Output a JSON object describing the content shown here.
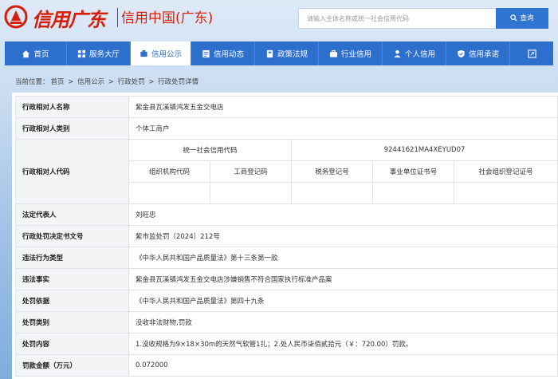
{
  "header": {
    "logo_script": "信用广东",
    "logo_cn": "信用中国(广东)",
    "search_placeholder": "请输入主体名称或统一社会信用代码",
    "search_button": "查询",
    "colors": {
      "brand_red": "#d81e06",
      "nav_blue": "#2c6fcc"
    }
  },
  "nav": {
    "items": [
      {
        "label": "首页",
        "icon": "home-icon",
        "active": false
      },
      {
        "label": "服务大厅",
        "icon": "grid-icon",
        "active": false
      },
      {
        "label": "信用公示",
        "icon": "announce-icon",
        "active": true
      },
      {
        "label": "信用动态",
        "icon": "news-icon",
        "active": false
      },
      {
        "label": "政策法规",
        "icon": "book-icon",
        "active": false
      },
      {
        "label": "行业信用",
        "icon": "briefcase-icon",
        "active": false
      },
      {
        "label": "个人信用",
        "icon": "person-icon",
        "active": false
      },
      {
        "label": "信用承诺",
        "icon": "shield-check-icon",
        "active": false
      }
    ],
    "end_icon": "expand-icon"
  },
  "breadcrumb": {
    "prefix": "当前位置：",
    "items": [
      "首页",
      "信用公示",
      "行政处罚",
      "行政处罚详情"
    ],
    "separator": ">"
  },
  "detail": {
    "name_label": "行政相对人名称",
    "name_value": "紫金县瓦溪镇鸿发五金交电店",
    "type_label": "行政相对人类别",
    "type_value": "个体工商户",
    "code_label": "行政相对人代码",
    "uscc_label": "统一社会信用代码",
    "uscc_value": "92441621MA4XEYUD07",
    "sub_headers": [
      "组织机构代码",
      "工商登记码",
      "税务登记号",
      "事业单位证书号",
      "社会组织登记证号"
    ],
    "sub_values": [
      "",
      "",
      "",
      "",
      ""
    ],
    "legal_label": "法定代表人",
    "legal_value": "刘旺忠",
    "doc_label": "行政处罚决定书文号",
    "doc_value": "紫市监处罚〔2024〕212号",
    "violation_type_label": "违法行为类型",
    "violation_type_value": "《中华人民共和国产品质量法》第十三条第一款",
    "facts_label": "违法事实",
    "facts_value": "紫金县瓦溪镇鸿发五金交电店涉嫌销售不符合国家执行标准产品案",
    "basis_label": "处罚依据",
    "basis_value": "《中华人民共和国产品质量法》第四十九条",
    "category_label": "处罚类别",
    "category_value": "没收非法财物,罚款",
    "content_label": "处罚内容",
    "content_value": "1.没收规格为9×18×30m的天然气软管1扎；2.处人民币柒佰贰拾元（￥：720.00）罚款。",
    "amount_label": "罚款金额（万元）",
    "amount_value": "0.072000"
  }
}
